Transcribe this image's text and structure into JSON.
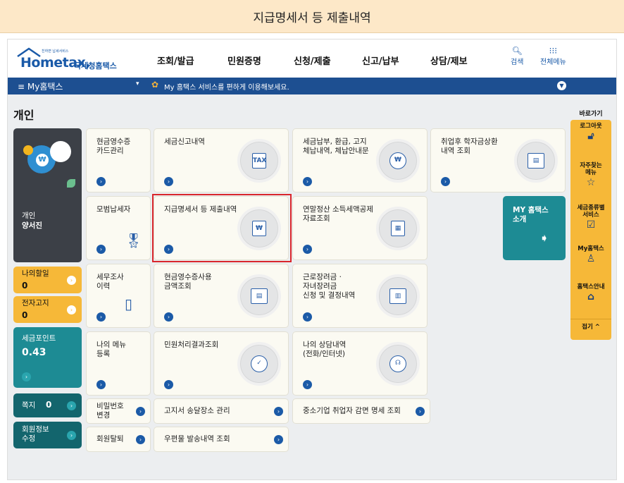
{
  "banner_title": "지급명세서 등 제출내역",
  "logo": {
    "brand": "Hometax,",
    "sub": "국세청홈택스",
    "tiny": "친하면 납세서비스"
  },
  "menu": [
    "조회/발급",
    "민원증명",
    "신청/제출",
    "신고/납부",
    "상담/제보"
  ],
  "tools": {
    "search": "검색",
    "all_menu": "전체메뉴"
  },
  "bar": {
    "my": "≡  My홈택스",
    "arrow": "▾",
    "message": "My 홈택스 서비스를 편하게 이용해보세요."
  },
  "page_title": "개인",
  "profile": {
    "label": "개인",
    "name": "양서진"
  },
  "side_boxes": [
    {
      "label": "나의할일",
      "value": "0"
    },
    {
      "label": "전자고지",
      "value": "0"
    },
    {
      "label": "세금포인트",
      "value": "0.43"
    },
    {
      "label": "쪽지",
      "value": "0"
    },
    {
      "label": "회원정보\n수정",
      "value": ""
    }
  ],
  "tiles": [
    "현금영수증\n카드관리",
    "세금신고내역",
    "세금납부, 환급, 고지\n체납내역, 체납안내문",
    "취업후 학자금상환\n내역 조회",
    "모범납세자",
    "지급명세서 등 제출내역",
    "연말정산 소득세액공제\n자료조회",
    "세무조사\n이력",
    "현금영수증사용\n금액조회",
    "근로장려금 ·\n자녀장려금\n신청 및 결정내역",
    "나의 메뉴\n등록",
    "민원처리결과조회",
    "나의 상담내역\n(전화/인터넷)",
    "비밀번호\n변경",
    "고지서 송달장소 관리",
    "중소기업 취업자 감면 명세 조회",
    "회원탈퇴",
    "우편물 발송내역 조회"
  ],
  "my_hometax": "MY 홈택스\n소개",
  "quick": {
    "title": "바로가기",
    "items": [
      "로그아웃",
      "자주찾는\n메뉴",
      "세금종류별\n서비스",
      "My홈택스",
      "홈택스안내",
      "접기 ^"
    ]
  },
  "colors": {
    "nav_bar": "#1d4f91",
    "dark_tile": "#3c4047",
    "yellow_tile": "#f6b838",
    "teal_tile": "#1d8b94",
    "dark_teal": "#13656d",
    "highlight": "#d9262c"
  }
}
